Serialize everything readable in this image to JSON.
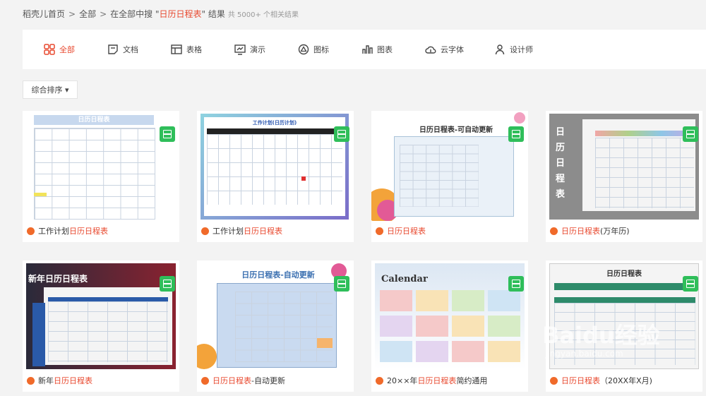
{
  "breadcrumb": {
    "home": "稻壳儿首页",
    "all": "全部",
    "search_prefix": "在全部中搜 \"",
    "keyword": "日历日程表",
    "search_suffix": "\" 结果",
    "count": "共 5000+ 个相关结果"
  },
  "tabs": [
    {
      "label": "全部",
      "icon": "grid-icon"
    },
    {
      "label": "文档",
      "icon": "document-icon"
    },
    {
      "label": "表格",
      "icon": "table-icon"
    },
    {
      "label": "演示",
      "icon": "presentation-icon"
    },
    {
      "label": "图标",
      "icon": "triangle-icon"
    },
    {
      "label": "图表",
      "icon": "bar-chart-icon"
    },
    {
      "label": "云字体",
      "icon": "cloud-font-icon"
    },
    {
      "label": "设计师",
      "icon": "person-icon"
    }
  ],
  "sort": {
    "label": "综合排序 ▾"
  },
  "cards": [
    {
      "pre": "工作计划",
      "hl": "日历日程表",
      "post": "",
      "thumb_title": "日历日程表"
    },
    {
      "pre": "工作计划",
      "hl": "日历日程表",
      "post": "",
      "thumb_title": "工作计划(日历计划)"
    },
    {
      "pre": "",
      "hl": "日历日程表",
      "post": "",
      "thumb_title": "日历日程表-可自动更新"
    },
    {
      "pre": "",
      "hl": "日历日程表",
      "post": "(万年历)",
      "thumb_title": "日历日程表"
    },
    {
      "pre": "新年",
      "hl": "日历日程表",
      "post": "",
      "thumb_title": "新年日历日程表"
    },
    {
      "pre": "",
      "hl": "日历日程表",
      "post": "-自动更新",
      "thumb_title": "日历日程表-自动更新"
    },
    {
      "pre": "20××年",
      "hl": "日历日程表",
      "post": "简约通用",
      "thumb_title": "Calendar"
    },
    {
      "pre": "",
      "hl": "日历日程表",
      "post": "（20XX年X月)",
      "thumb_title": "日历日程表"
    }
  ],
  "watermark": "Baidu经验",
  "watermark_url": "jingyan.baidu.com",
  "colors": {
    "accent": "#e8492f",
    "badge": "#2fbe5a"
  }
}
